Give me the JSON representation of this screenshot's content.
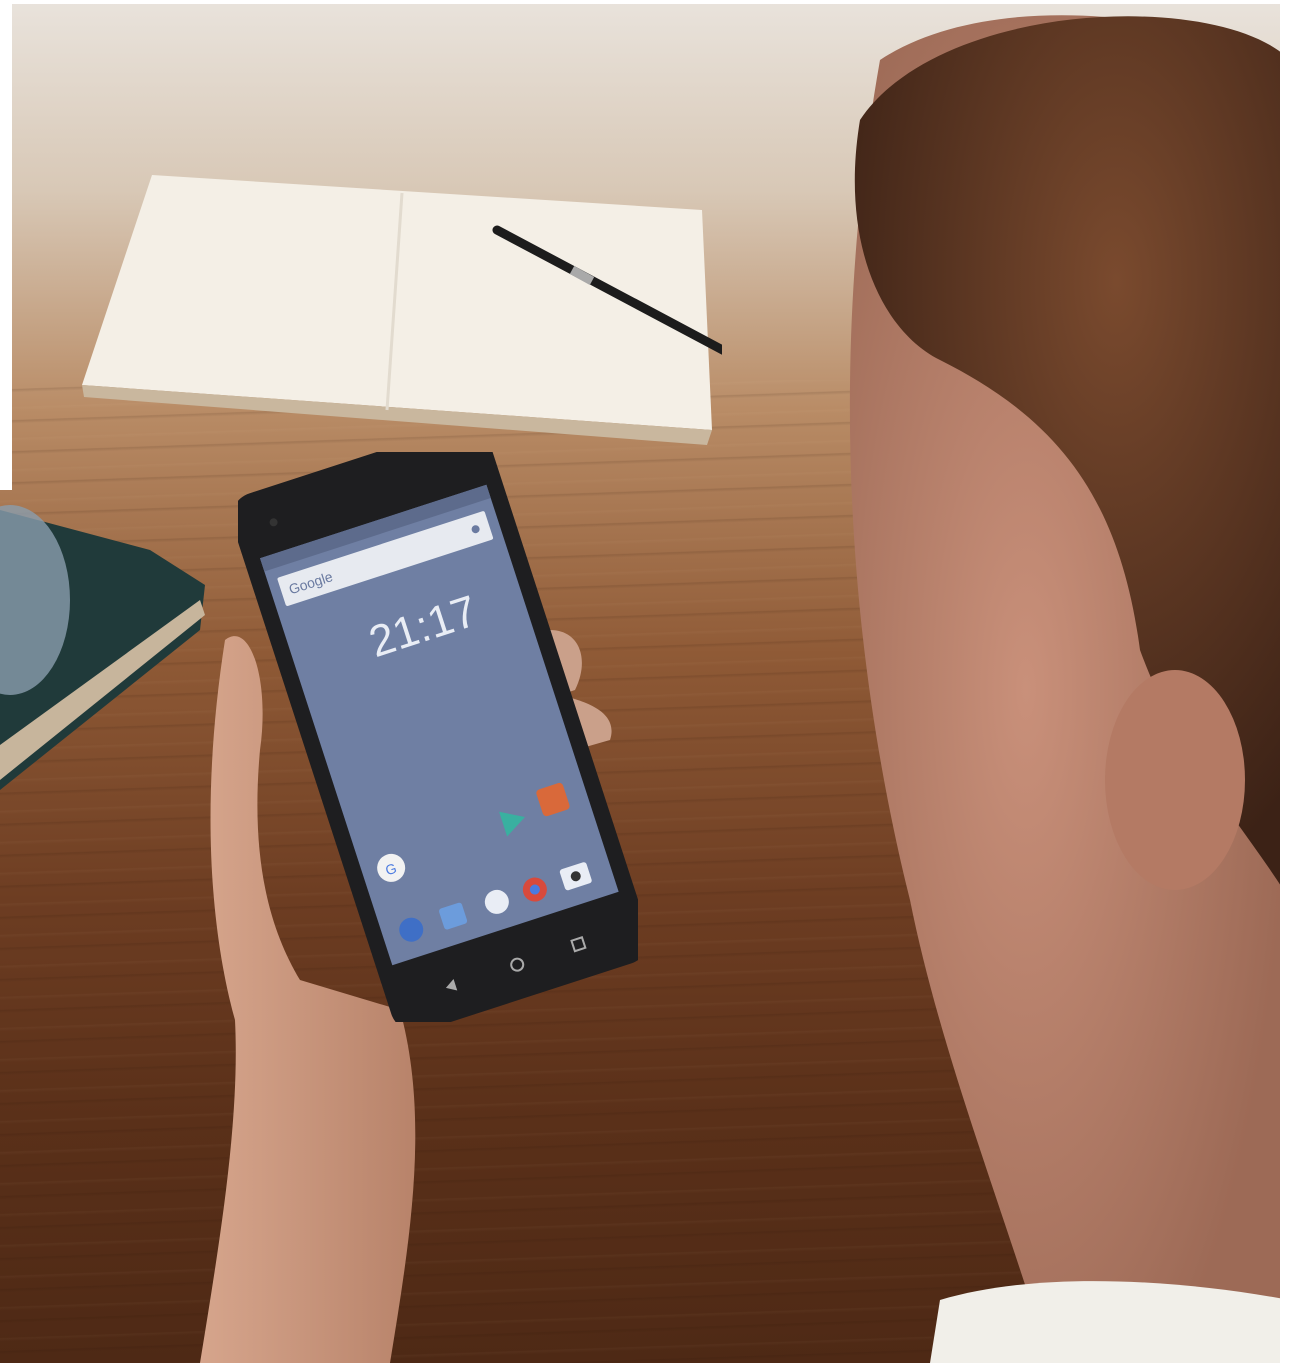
{
  "photo": {
    "subject": "",
    "phone_screen": {
      "search_brand": "Google",
      "clock": "21:17",
      "nav_icons": [
        "back-icon",
        "home-icon",
        "recents-icon"
      ],
      "dock_icons": [
        "phone-icon",
        "messages-icon",
        "app-drawer-icon",
        "chrome-icon",
        "camera-icon"
      ],
      "home_icons": [
        "google-app-icon",
        "play-store-icon",
        "app-icon"
      ]
    }
  },
  "colors": {
    "table": "#6d3d22",
    "screen": "#6f7fa3",
    "phone_body": "#1e1e20"
  }
}
